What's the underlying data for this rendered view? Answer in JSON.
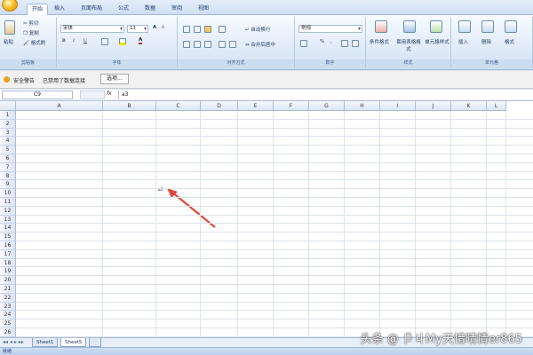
{
  "tabs": [
    "开始",
    "插入",
    "页面布局",
    "公式",
    "数据",
    "审阅",
    "视图"
  ],
  "ribbon": {
    "clipboard": {
      "paste": "粘贴",
      "cut": "剪切",
      "copy": "复制",
      "format_painter": "格式刷",
      "label": "剪贴板"
    },
    "font": {
      "name": "宋体",
      "size": "11",
      "label": "字体",
      "bold": "B",
      "italic": "I",
      "underline": "U",
      "grow": "A",
      "shrink": "A"
    },
    "alignment": {
      "wrap": "自动换行",
      "merge": "合并后居中",
      "label": "对齐方式"
    },
    "number": {
      "format": "常规",
      "percent": "%",
      "comma": ",",
      "label": "数字"
    },
    "styles": {
      "conditional": "条件格式",
      "table": "套用表格格式",
      "cell": "单元格样式",
      "label": "样式"
    },
    "cells": {
      "insert": "插入",
      "delete": "删除",
      "format": "格式",
      "label": "单元格"
    }
  },
  "security_bar": {
    "title": "安全警告",
    "message": "已禁用了数据连接",
    "options_button": "选项..."
  },
  "formula_bar": {
    "name_box": "C9",
    "fx": "fx",
    "value": "a3"
  },
  "columns": [
    "A",
    "B",
    "C",
    "D",
    "E",
    "F",
    "G",
    "H",
    "I",
    "J",
    "K",
    "L"
  ],
  "rows": [
    "1",
    "2",
    "3",
    "4",
    "5",
    "6",
    "7",
    "8",
    "9",
    "10",
    "11",
    "12",
    "13",
    "14",
    "15",
    "16",
    "17",
    "18",
    "19",
    "20",
    "21",
    "22",
    "23",
    "24",
    "25",
    "26"
  ],
  "cell_c9": "a3",
  "sheets": [
    "Sheet1",
    "Sheet5"
  ],
  "status": "就绪",
  "watermark": "头条 @ 卩丩My天惜晴情er865"
}
